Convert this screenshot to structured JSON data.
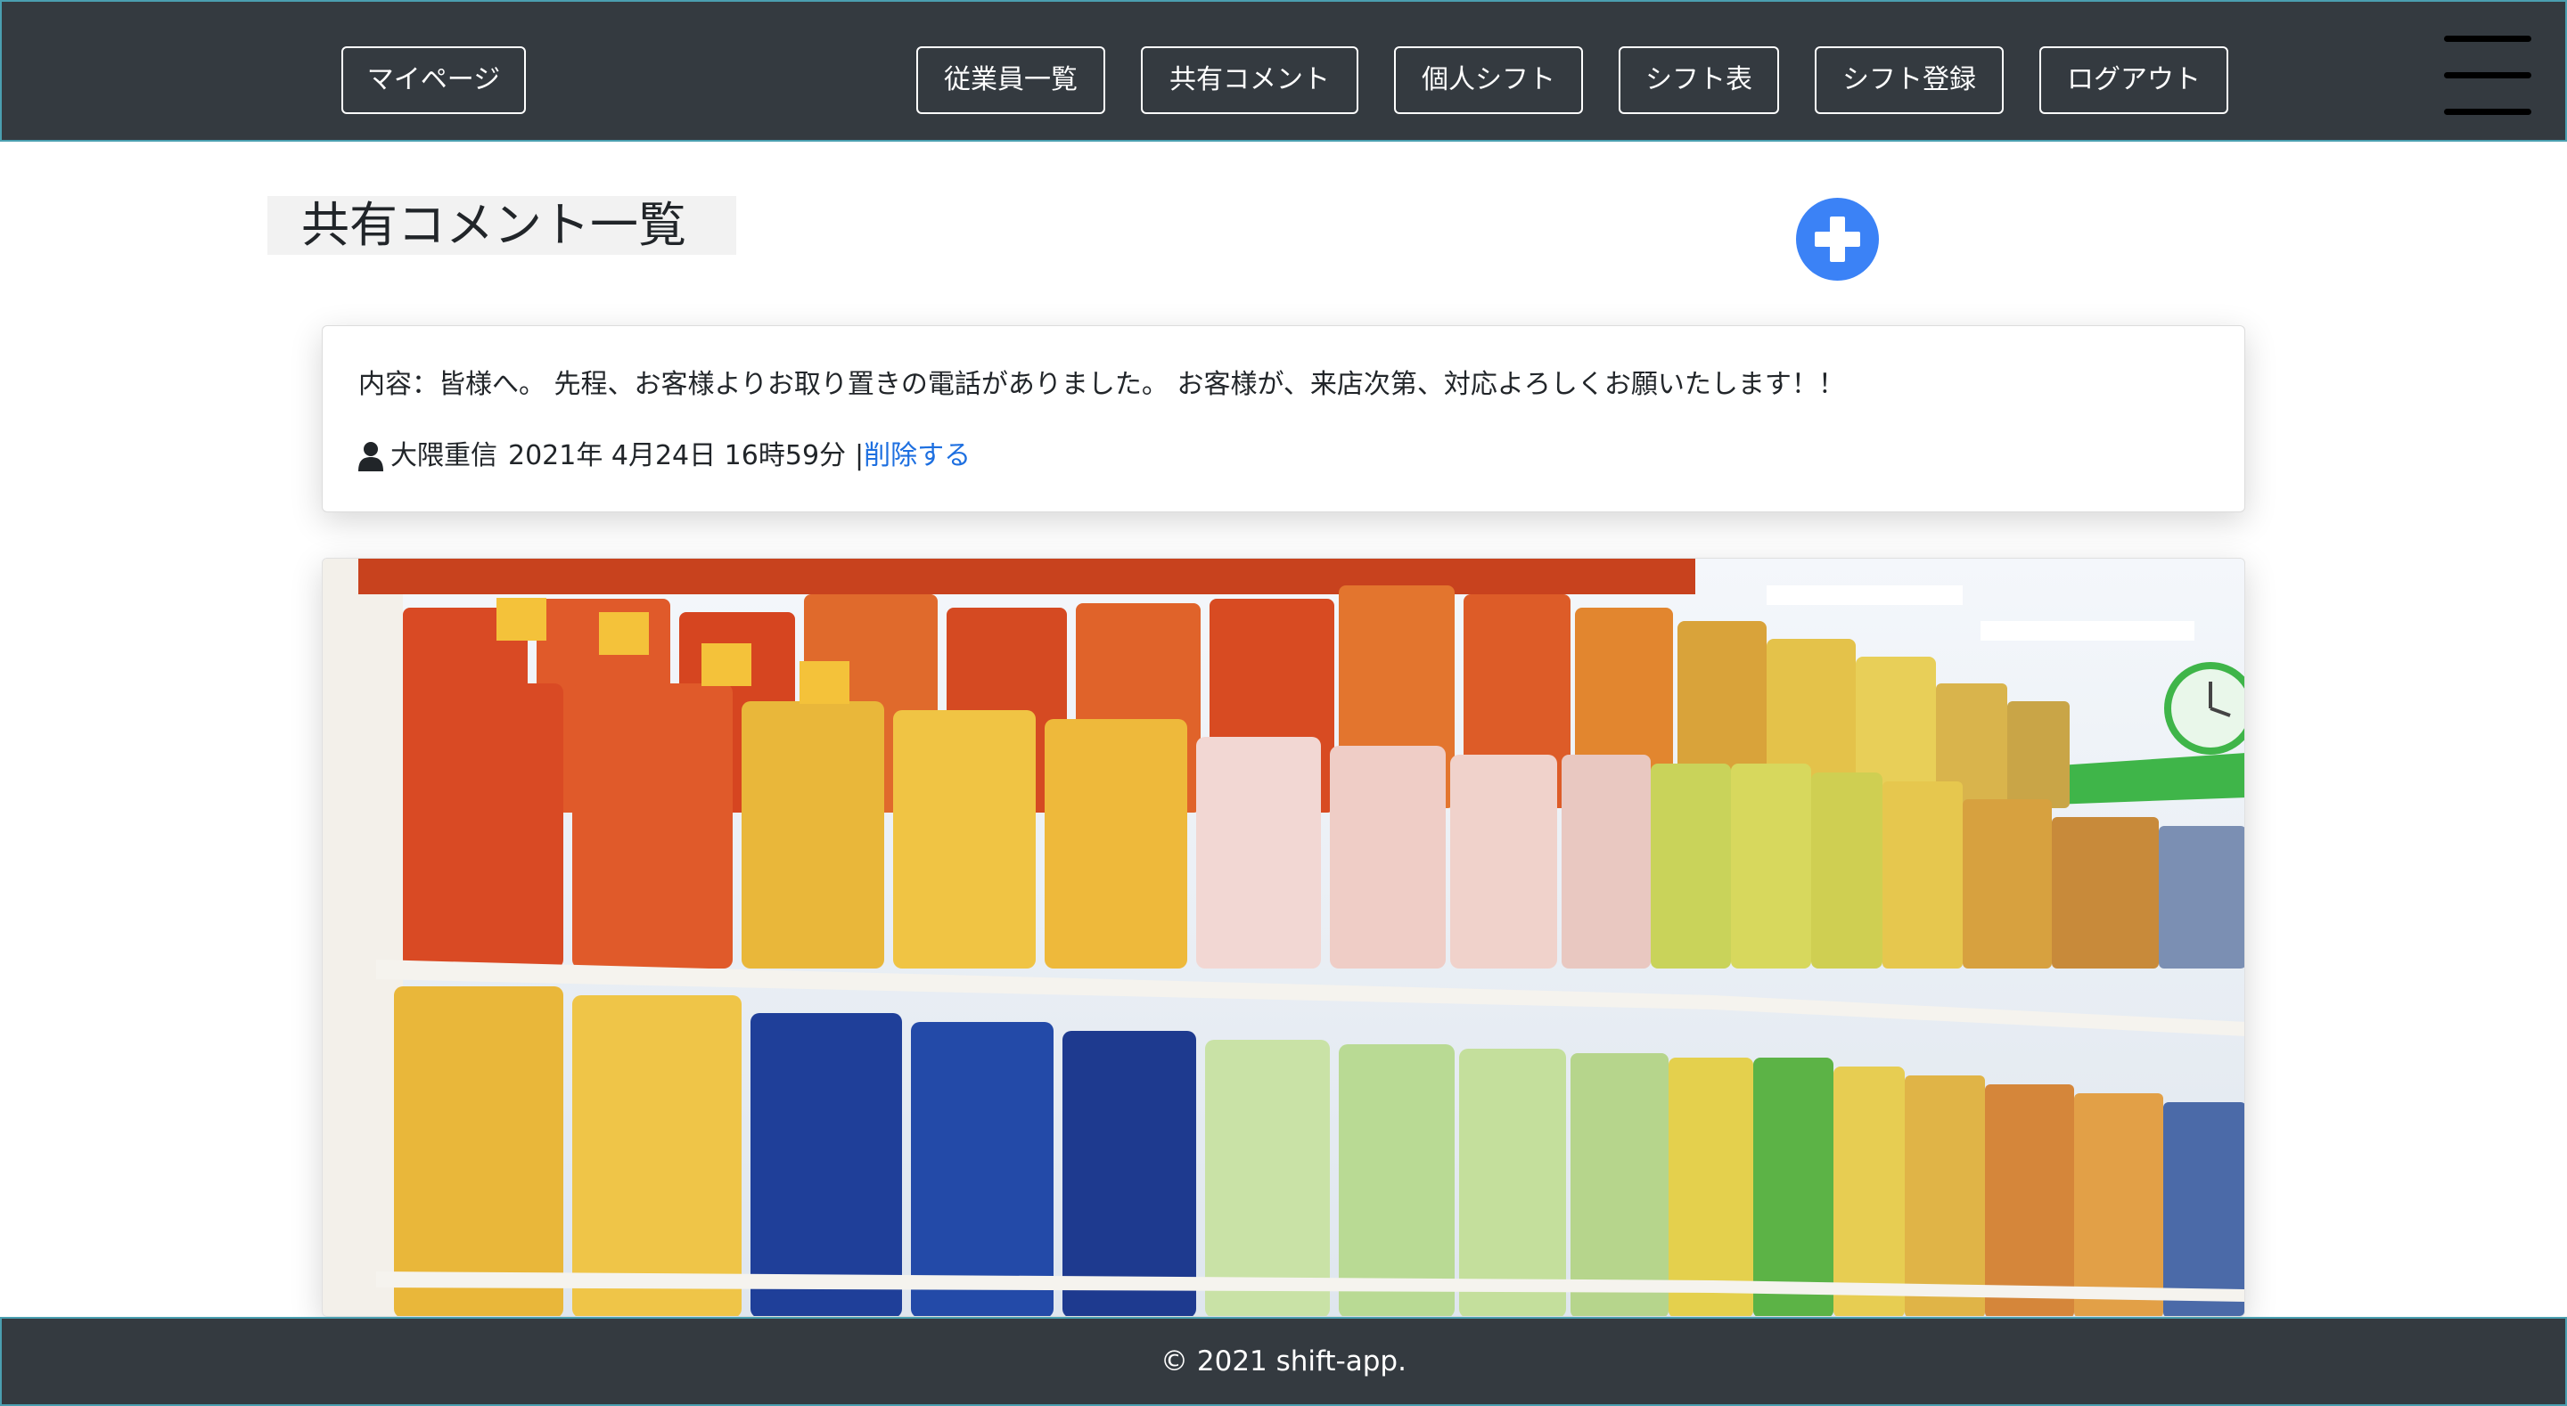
{
  "header": {
    "mypage_label": "マイページ",
    "nav": [
      {
        "label": "従業員一覧"
      },
      {
        "label": "共有コメント"
      },
      {
        "label": "個人シフト"
      },
      {
        "label": "シフト表"
      },
      {
        "label": "シフト登録"
      },
      {
        "label": "ログアウト"
      }
    ],
    "menu_icon": "hamburger-menu-icon"
  },
  "main": {
    "title": "共有コメント一覧",
    "add_icon": "plus-circle-icon",
    "comment": {
      "content": "内容：皆様へ。 先程、お客様よりお取り置きの電話がありました。 お客様が、来店次第、対応よろしくお願いたします！！",
      "user_icon": "user-icon",
      "author": "大隈重信",
      "datetime": "2021年 4月24日 16時59分",
      "separator": "|",
      "delete_label": "削除する"
    },
    "photo": {
      "subject": "store-shelf-snack-photo"
    }
  },
  "footer": {
    "copyright": "© 2021 shift-app."
  },
  "colors": {
    "navbar_bg": "#343a40",
    "accent_blue": "#3b82f6",
    "link_blue": "#1d6fe0"
  }
}
